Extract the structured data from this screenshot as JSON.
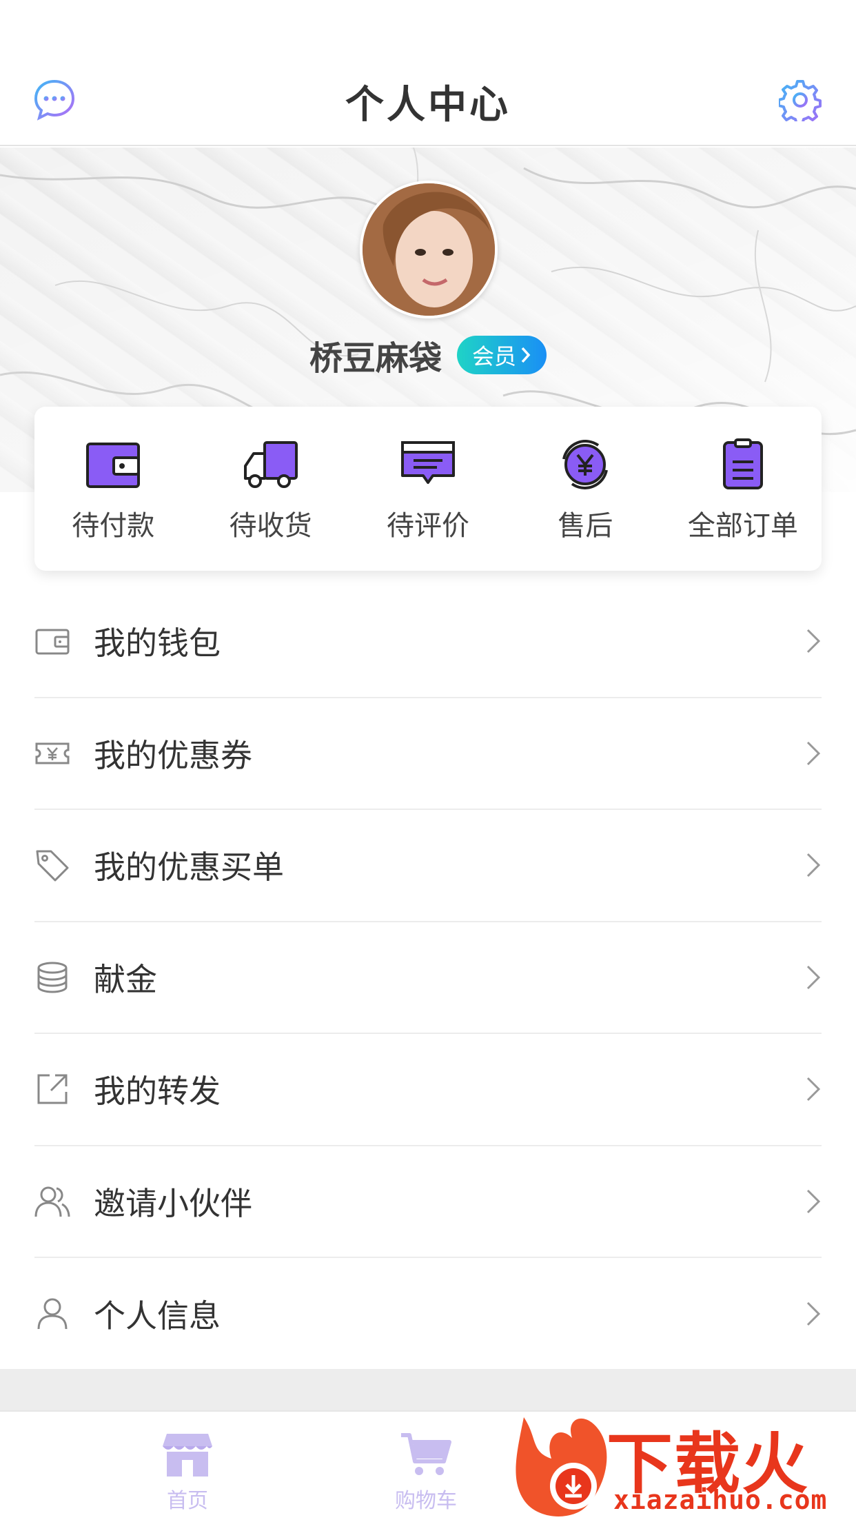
{
  "header": {
    "title": "个人中心"
  },
  "profile": {
    "name": "桥豆麻袋",
    "member_label": "会员"
  },
  "orders": [
    {
      "label": "待付款",
      "icon": "wallet-icon"
    },
    {
      "label": "待收货",
      "icon": "truck-icon"
    },
    {
      "label": "待评价",
      "icon": "comment-icon"
    },
    {
      "label": "售后",
      "icon": "yen-refresh-icon"
    },
    {
      "label": "全部订单",
      "icon": "clipboard-icon"
    }
  ],
  "menu": [
    {
      "label": "我的钱包",
      "icon": "wallet-outline-icon"
    },
    {
      "label": "我的优惠券",
      "icon": "coupon-icon"
    },
    {
      "label": "我的优惠买单",
      "icon": "tag-icon"
    },
    {
      "label": "献金",
      "icon": "coins-icon"
    },
    {
      "label": "我的转发",
      "icon": "share-icon"
    },
    {
      "label": "邀请小伙伴",
      "icon": "friends-icon"
    },
    {
      "label": "个人信息",
      "icon": "user-icon"
    }
  ],
  "tabbar": [
    {
      "label": "首页",
      "icon": "store-icon"
    },
    {
      "label": "购物车",
      "icon": "cart-icon"
    }
  ],
  "watermark": {
    "text": "下载火",
    "url": "xiazaihuo.com"
  },
  "colors": {
    "accent": "#8a5cf5",
    "badge_start": "#1fd3c6",
    "badge_end": "#1a8ff5",
    "watermark": "#e8361c"
  }
}
